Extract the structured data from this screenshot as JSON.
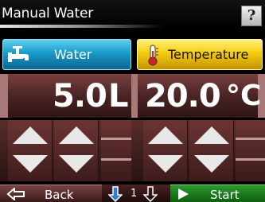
{
  "title": "Manual Water",
  "help_label": "?",
  "params": {
    "water": {
      "label": "Water",
      "icon": "faucet-icon",
      "color": "#1899c9"
    },
    "temperature": {
      "label": "Temperature",
      "icon": "thermometer-icon",
      "color": "#f5cc10"
    }
  },
  "values": {
    "water": {
      "value": "5.0",
      "unit": "L"
    },
    "temperature": {
      "value": "20.0",
      "unit": "°C"
    }
  },
  "footer": {
    "back_label": "Back",
    "page_number": "1",
    "start_label": "Start"
  },
  "colors": {
    "panel": "#4a2424",
    "start": "#2c9a2c"
  }
}
